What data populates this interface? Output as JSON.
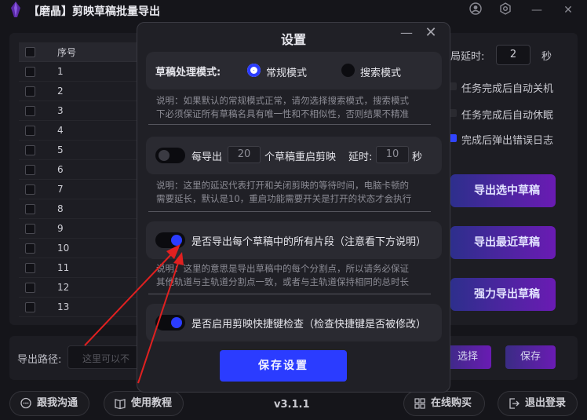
{
  "app": {
    "title": "【磨晶】剪映草稿批量导出",
    "version": "v3.1.1"
  },
  "table": {
    "col_seq": "序号",
    "rows": [
      "1",
      "2",
      "3",
      "4",
      "5",
      "6",
      "7",
      "8",
      "9",
      "10",
      "11",
      "12",
      "13"
    ]
  },
  "right": {
    "delay_label": "局延时:",
    "delay_value": "2",
    "delay_unit": "秒",
    "opt_shutdown": "任务完成后自动关机",
    "opt_sleep": "任务完成后自动休眠",
    "opt_errorlog": "完成后弹出错误日志",
    "btn_export_selected": "导出选中草稿",
    "btn_export_recent": "导出最近草稿",
    "btn_force_export": "强力导出草稿"
  },
  "path": {
    "label": "导出路径:",
    "placeholder": "这里可以不",
    "choose": "选择",
    "save": "保存"
  },
  "footer": {
    "chat": "跟我沟通",
    "tutorial": "使用教程",
    "buy": "在线购买",
    "logout": "退出登录"
  },
  "modal": {
    "title": "设置",
    "mode_label": "草稿处理模式:",
    "mode_normal": "常规模式",
    "mode_search": "搜索模式",
    "mode_selected": "常规模式",
    "note1_line1": "说明：如果默认的常规模式正常，请勿选择搜索模式，搜索模式",
    "note1_line2": "下必须保证所有草稿名具有唯一性和不相似性，否则结果不精准",
    "restart_prefix": "每导出",
    "restart_count": "20",
    "restart_suffix": "个草稿重启剪映",
    "restart_delay_label": "延时:",
    "restart_delay_value": "10",
    "restart_delay_unit": "秒",
    "restart_enabled": false,
    "note2_line1": "说明：这里的延迟代表打开和关闭剪映的等待时间，电脑卡顿的",
    "note2_line2": "需要延长，默认是10，重启功能需要开关是打开的状态才会执行",
    "segments_label": "是否导出每个草稿中的所有片段（注意看下方说明）",
    "segments_enabled": true,
    "note3_line1": "说明：这里的意思是导出草稿中的每个分割点，所以请务必保证",
    "note3_line2": "其他轨道与主轨道分割点一致，或者与主轨道保持相同的总时长",
    "hotkey_label": "是否启用剪映快捷键检查（检查快捷键是否被修改）",
    "hotkey_enabled": true,
    "save_button": "保存设置"
  },
  "colors": {
    "accent": "#2b3cff",
    "arrow": "#e02020"
  }
}
